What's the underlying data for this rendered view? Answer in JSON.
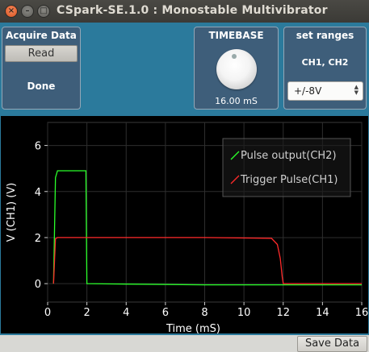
{
  "window": {
    "title": "CSpark-SE.1.0 : Monostable Multivibrator"
  },
  "acquire": {
    "title": "Acquire Data",
    "read_label": "Read",
    "status": "Done"
  },
  "timebase": {
    "title": "TIMEBASE",
    "value": "16.00 mS"
  },
  "ranges": {
    "title": "set ranges",
    "channels": "CH1, CH2",
    "selected": "+/-8V"
  },
  "footer": {
    "save_label": "Save Data"
  },
  "colors": {
    "ch1": "#ff2a2a",
    "ch2": "#2aff2a",
    "panel": "#3e5e7a",
    "background": "#2b7a9c"
  },
  "chart_data": {
    "type": "line",
    "xlabel": "Time (mS)",
    "ylabel": "V (CH1) (V)",
    "xlim": [
      0,
      16
    ],
    "ylim": [
      -0.8,
      7
    ],
    "xticks": [
      "0",
      "2",
      "4",
      "6",
      "8",
      "10",
      "12",
      "14",
      "16"
    ],
    "yticks": [
      "0",
      "2",
      "4",
      "6"
    ],
    "grid": true,
    "legend_position": "top-right",
    "series": [
      {
        "name": "Pulse output(CH2)",
        "color": "#2aff2a",
        "x": [
          0.3,
          0.4,
          0.5,
          1.95,
          1.95,
          2.0,
          4,
          8,
          12,
          14,
          16
        ],
        "y": [
          0,
          4.6,
          4.9,
          4.9,
          4.8,
          0,
          -0.02,
          -0.05,
          -0.05,
          -0.05,
          -0.05
        ]
      },
      {
        "name": "Trigger Pulse(CH1)",
        "color": "#ff2a2a",
        "x": [
          0.3,
          0.4,
          0.5,
          4,
          8,
          11.4,
          11.7,
          11.85,
          11.95,
          12.0,
          16
        ],
        "y": [
          0,
          1.95,
          2.0,
          2.0,
          2.0,
          1.97,
          1.7,
          1.1,
          0.3,
          0,
          0
        ]
      }
    ]
  }
}
